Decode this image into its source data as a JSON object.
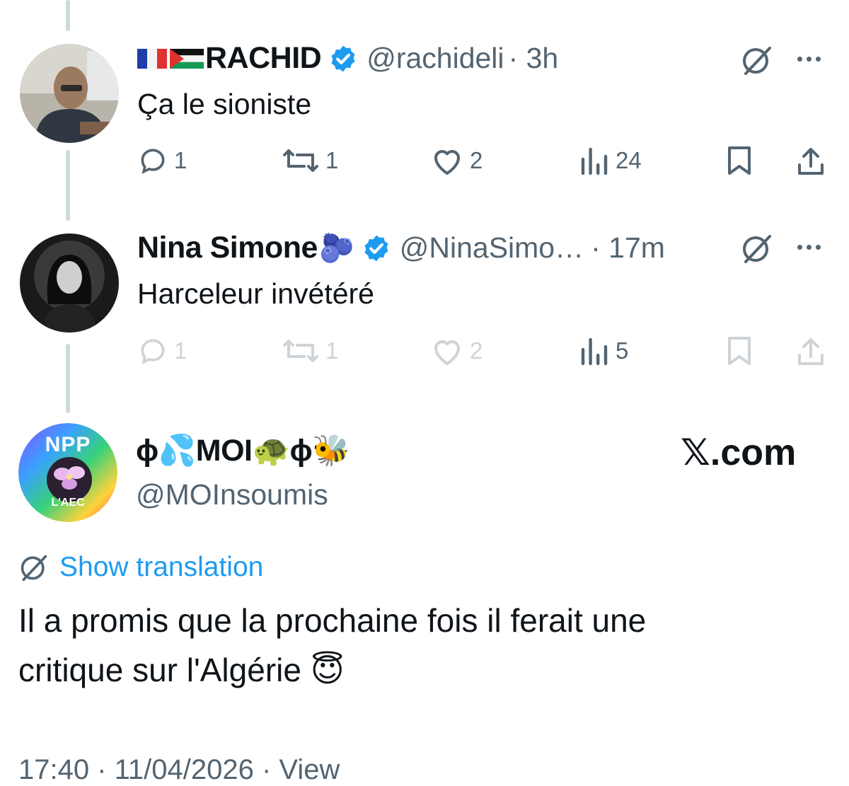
{
  "replies": [
    {
      "display_name": "RACHID",
      "flags": [
        "france-flag",
        "palestine-flag"
      ],
      "handle": "@rachideli",
      "time": "· 3h",
      "text": "Ça le sioniste",
      "stats": {
        "replies": "1",
        "reposts": "1",
        "likes": "2",
        "views": "24"
      }
    },
    {
      "display_name": "Nina Simone",
      "emoji": "🫐",
      "handle": "@NinaSimo…",
      "time": "· 17m",
      "text": "Harceleur invétéré",
      "stats": {
        "replies": "1",
        "reposts": "1",
        "likes": "2",
        "views": "5"
      }
    }
  ],
  "main_post": {
    "display_name": "ɸ💦MOI🐢ɸ🐝",
    "handle": "@MOInsoumis",
    "avatar_text_top": "NPP",
    "avatar_text_bottom": "L'AEC",
    "show_translation": "Show translation",
    "text_line1": "Il a promis que la prochaine fois il ferait une",
    "text_line2": "critique sur l'Algérie 😇",
    "meta": "17:40 · 11/04/2026 · View"
  },
  "watermark": "𝕏.com",
  "colors": {
    "verified": "#1d9bf0",
    "link": "#1d9bf0",
    "muted": "#536471"
  }
}
